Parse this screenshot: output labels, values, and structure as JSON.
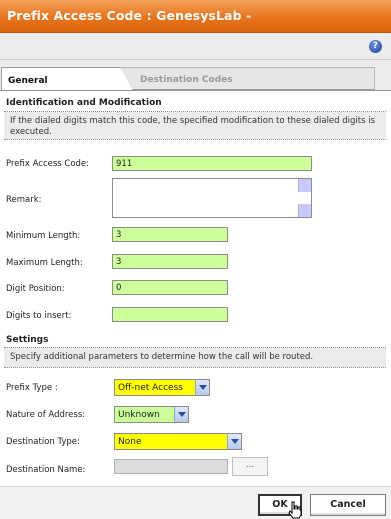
{
  "window": {
    "title": "Prefix Access Code : GenesysLab -"
  },
  "toolbar": {
    "help_icon": "help-icon"
  },
  "tabs": [
    {
      "label": "General",
      "selected": true
    },
    {
      "label": "Destination Codes",
      "selected": false
    }
  ],
  "identification": {
    "heading": "Identification and Modification",
    "info": "If the dialed digits match this code, the specified modification to these dialed digits is executed.",
    "fields": {
      "prefix_access_code": {
        "label": "Prefix Access Code:",
        "value": "911"
      },
      "remark": {
        "label": "Remark:",
        "value": ""
      },
      "minimum_length": {
        "label": "Minimum Length:",
        "value": "3"
      },
      "maximum_length": {
        "label": "Maximum Length:",
        "value": "3"
      },
      "digit_position": {
        "label": "Digit Position:",
        "value": "0"
      },
      "digits_to_insert": {
        "label": "Digits to insert:",
        "value": ""
      }
    }
  },
  "settings": {
    "heading": "Settings",
    "info": "Specify additional parameters to determine how the call will be routed.",
    "fields": {
      "prefix_type": {
        "label": "Prefix Type :",
        "value": "Off-net Access"
      },
      "nature_of_address": {
        "label": "Nature of Address:",
        "value": "Unknown"
      },
      "destination_type": {
        "label": "Destination Type:",
        "value": "None"
      },
      "destination_name": {
        "label": "Destination Name:",
        "value": "",
        "browse_label": "..."
      }
    }
  },
  "buttons": {
    "ok": "OK",
    "cancel": "Cancel"
  },
  "colors": {
    "title_bar": "#e8741c",
    "editable_field": "#ccff99",
    "required_select": "#ffff00"
  }
}
